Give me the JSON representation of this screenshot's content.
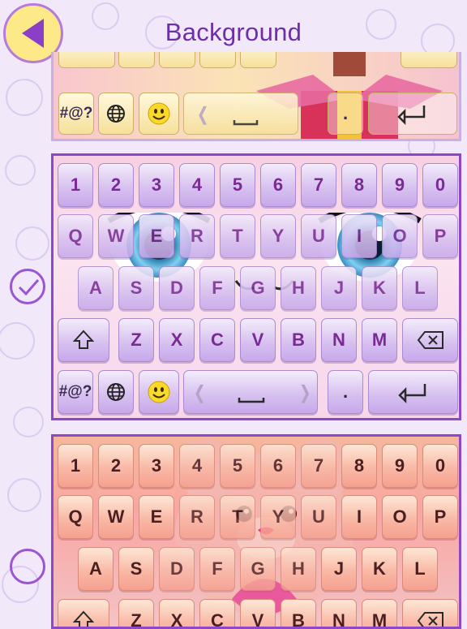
{
  "header": {
    "title": "Background"
  },
  "keyboards": [
    {
      "selected": false,
      "bottom_row": {
        "symbols": "#@?",
        "period": "."
      }
    },
    {
      "selected": true,
      "number_row": [
        "1",
        "2",
        "3",
        "4",
        "5",
        "6",
        "7",
        "8",
        "9",
        "0"
      ],
      "row_q": [
        "Q",
        "W",
        "E",
        "R",
        "T",
        "Y",
        "U",
        "I",
        "O",
        "P"
      ],
      "row_a": [
        "A",
        "S",
        "D",
        "F",
        "G",
        "H",
        "J",
        "K",
        "L"
      ],
      "row_z": [
        "Z",
        "X",
        "C",
        "V",
        "B",
        "N",
        "M"
      ],
      "bottom_row": {
        "symbols": "#@?",
        "period": "."
      }
    },
    {
      "selected": false,
      "number_row": [
        "1",
        "2",
        "3",
        "4",
        "5",
        "6",
        "7",
        "8",
        "9",
        "0"
      ],
      "row_q": [
        "Q",
        "W",
        "E",
        "R",
        "T",
        "Y",
        "U",
        "I",
        "O",
        "P"
      ],
      "row_a": [
        "A",
        "S",
        "D",
        "F",
        "G",
        "H",
        "J",
        "K",
        "L"
      ],
      "row_z": [
        "Z",
        "X",
        "C",
        "V",
        "B",
        "N",
        "M"
      ]
    }
  ],
  "colors": {
    "accent": "#8d47c8",
    "title": "#6d2ea8",
    "back_button": "#fde987",
    "back_arrow": "#8a3fc6"
  },
  "icons": [
    "back-arrow-icon",
    "globe-icon",
    "smiley-icon",
    "shift-icon",
    "backspace-icon",
    "return-icon",
    "checkmark-icon"
  ]
}
